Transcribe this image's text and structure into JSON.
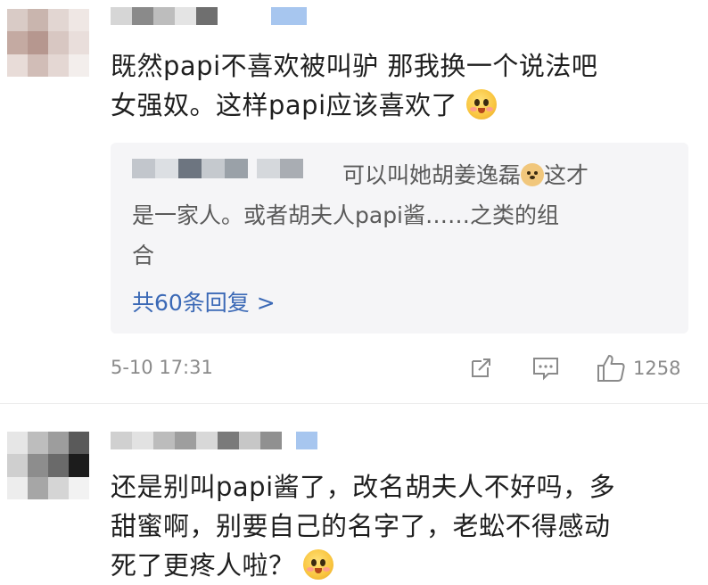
{
  "comments": [
    {
      "text_line1": "既然papi不喜欢被叫驴 那我换一个说法吧",
      "text_line2": "女强奴。这样papi应该喜欢了",
      "emoji": "blush-emoji",
      "reply": {
        "line1": "可以叫她胡姜逸磊",
        "emoji": "doge-emoji",
        "line1_tail": "这才",
        "line2": "是一家人。或者胡夫人papi酱……之类的组",
        "line3": "合"
      },
      "more_replies": "共60条回复 >",
      "timestamp": "5-10 17:31",
      "like_count": "1258",
      "icons": [
        "share-icon",
        "comment-icon",
        "like-icon"
      ]
    },
    {
      "text_line1": "还是别叫papi酱了，改名胡夫人不好吗，多",
      "text_line2": "甜蜜啊，别要自己的名字了，老蚣不得感动",
      "text_line3": "死了更疼人啦？",
      "emoji": "blush-emoji"
    }
  ],
  "colors": {
    "link": "#3b69b6",
    "reply_bg": "#f5f5f7",
    "meta": "#8a8a8a"
  }
}
